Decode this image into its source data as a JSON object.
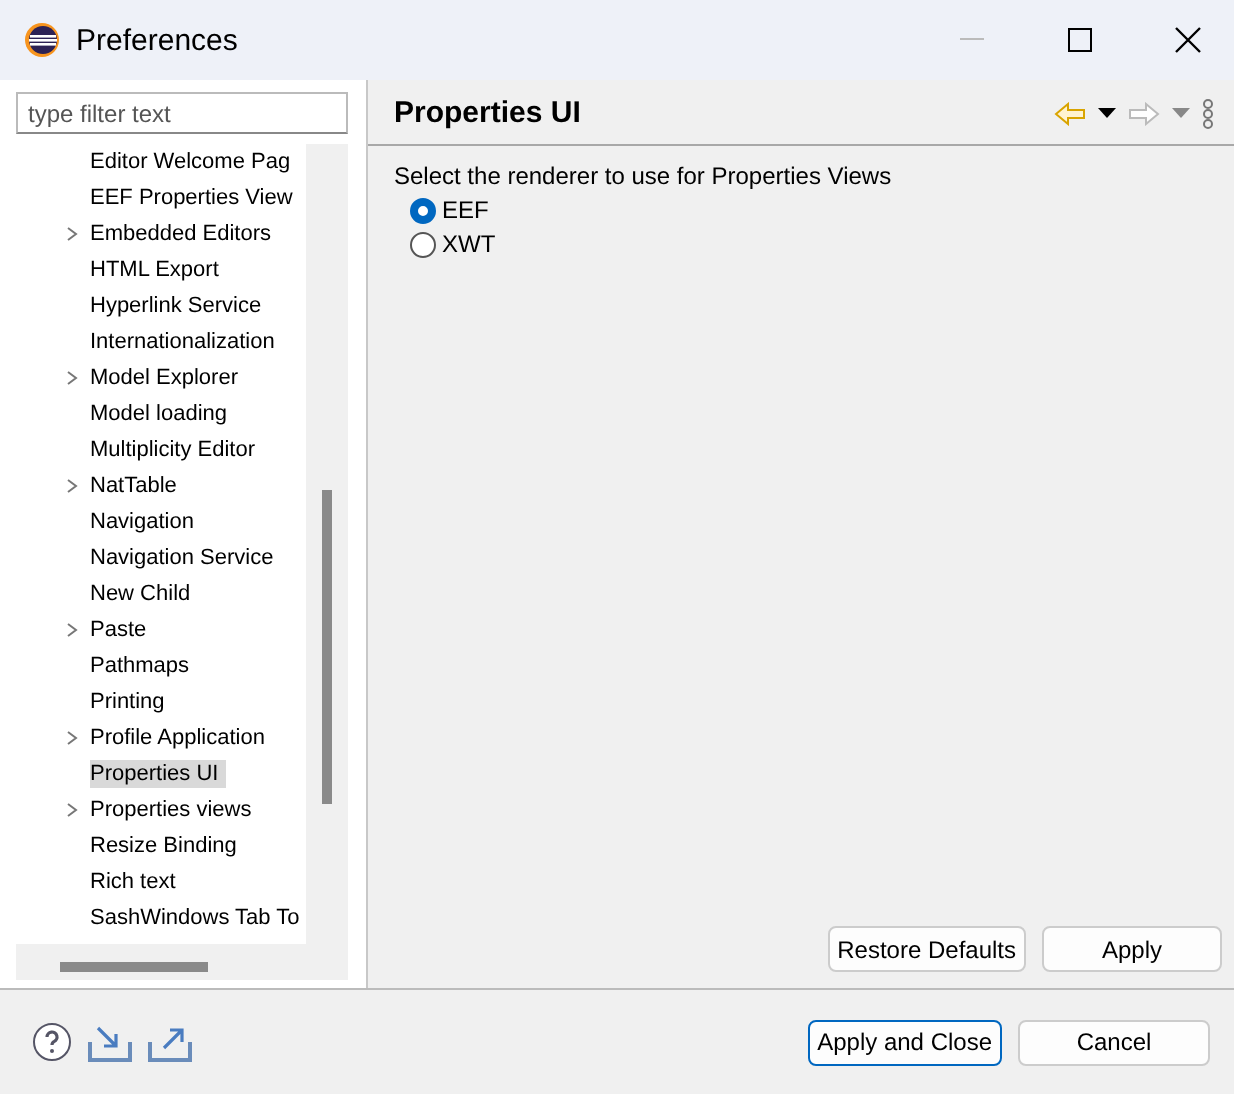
{
  "window": {
    "title": "Preferences"
  },
  "filter": {
    "placeholder": "type filter text"
  },
  "tree": [
    {
      "label": "Editor Welcome Pag",
      "expandable": false,
      "selected": false
    },
    {
      "label": "EEF Properties View",
      "expandable": false,
      "selected": false
    },
    {
      "label": "Embedded Editors",
      "expandable": true,
      "selected": false
    },
    {
      "label": "HTML Export",
      "expandable": false,
      "selected": false
    },
    {
      "label": "Hyperlink Service",
      "expandable": false,
      "selected": false
    },
    {
      "label": "Internationalization",
      "expandable": false,
      "selected": false
    },
    {
      "label": "Model Explorer",
      "expandable": true,
      "selected": false
    },
    {
      "label": "Model loading",
      "expandable": false,
      "selected": false
    },
    {
      "label": "Multiplicity Editor",
      "expandable": false,
      "selected": false
    },
    {
      "label": "NatTable",
      "expandable": true,
      "selected": false
    },
    {
      "label": "Navigation",
      "expandable": false,
      "selected": false
    },
    {
      "label": "Navigation Service",
      "expandable": false,
      "selected": false
    },
    {
      "label": "New Child",
      "expandable": false,
      "selected": false
    },
    {
      "label": "Paste",
      "expandable": true,
      "selected": false
    },
    {
      "label": "Pathmaps",
      "expandable": false,
      "selected": false
    },
    {
      "label": "Printing",
      "expandable": false,
      "selected": false
    },
    {
      "label": "Profile Application",
      "expandable": true,
      "selected": false
    },
    {
      "label": "Properties UI",
      "expandable": false,
      "selected": true
    },
    {
      "label": "Properties views",
      "expandable": true,
      "selected": false
    },
    {
      "label": "Resize Binding",
      "expandable": false,
      "selected": false
    },
    {
      "label": "Rich text",
      "expandable": false,
      "selected": false
    },
    {
      "label": "SashWindows Tab To",
      "expandable": false,
      "selected": false
    }
  ],
  "page": {
    "title": "Properties UI",
    "description": "Select the renderer to use for Properties Views",
    "options": [
      {
        "label": "EEF",
        "selected": true
      },
      {
        "label": "XWT",
        "selected": false
      }
    ],
    "buttons": [
      "Restore Defaults",
      "Apply"
    ]
  },
  "footer_buttons": [
    "Apply and Close",
    "Cancel"
  ]
}
